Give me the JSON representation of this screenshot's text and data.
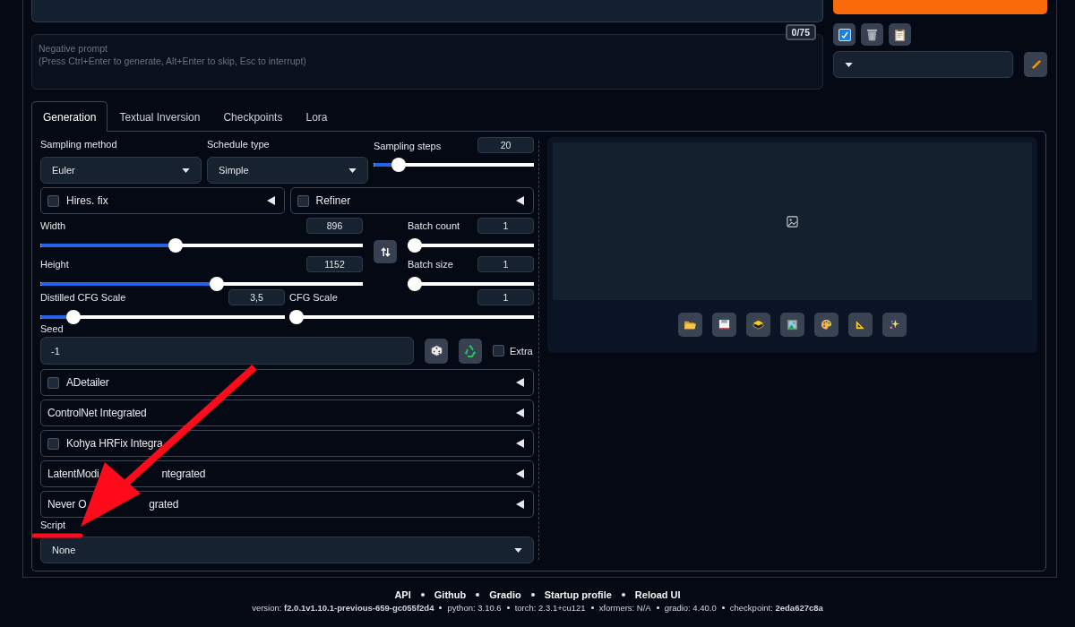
{
  "prompt": {
    "token_count": "0/75"
  },
  "negative_prompt": {
    "placeholder": "Negative prompt\n(Press Ctrl+Enter to generate, Alt+Enter to skip, Esc to interrupt)"
  },
  "tabs": [
    {
      "label": "Generation",
      "selected": true
    },
    {
      "label": "Textual Inversion",
      "selected": false
    },
    {
      "label": "Checkpoints",
      "selected": false
    },
    {
      "label": "Lora",
      "selected": false
    }
  ],
  "sampling_method": {
    "label": "Sampling method",
    "value": "Euler"
  },
  "schedule_type": {
    "label": "Schedule type",
    "value": "Simple"
  },
  "sampling_steps": {
    "label": "Sampling steps",
    "value": "20",
    "level": 0.122
  },
  "toggles": [
    {
      "label": "Hires. fix",
      "checked": false,
      "expanded": false
    },
    {
      "label": "Refiner",
      "checked": false,
      "expanded": false
    }
  ],
  "size_sliders": [
    {
      "label": "Width",
      "value": "896",
      "level": 0.417
    },
    {
      "label": "Height",
      "value": "1152",
      "level": 0.548
    }
  ],
  "batch_sliders": [
    {
      "label": "Batch count",
      "value": "1",
      "level": 0
    },
    {
      "label": "Batch size",
      "value": "1",
      "level": 0
    }
  ],
  "cfg_sliders": [
    {
      "label": "Distilled CFG Scale",
      "value": "3,5",
      "level": 0.113
    },
    {
      "label": "CFG Scale",
      "value": "1",
      "level": 0
    }
  ],
  "seed": {
    "label": "Seed",
    "value": "-1",
    "extra": {
      "label": "Extra",
      "checked": false
    }
  },
  "extensions": [
    {
      "kind": "checkbox",
      "label": "ADetailer",
      "checked": false,
      "expanded": false
    },
    {
      "kind": "plain",
      "label": "ControlNet Integrated",
      "expanded": false
    },
    {
      "kind": "checkbox",
      "label": "Kohya HRFix Integra",
      "checked": false,
      "expanded": false
    },
    {
      "kind": "plain",
      "label": "LatentModi",
      "label_after_arrow": "ntegrated",
      "expanded": false
    },
    {
      "kind": "plain",
      "label": "Never O",
      "label_after_arrow": "grated",
      "expanded": false
    }
  ],
  "script": {
    "label": "Script",
    "value": "None"
  },
  "footer": {
    "links": [
      "API",
      "Github",
      "Gradio",
      "Startup profile",
      "Reload UI"
    ],
    "versions": [
      "version: **f2.0.1v1.10.1-previous-659-gc055f2d4**",
      "python: 3.10.6",
      "torch: 2.3.1+cu121",
      "xformers: N/A",
      "gradio: 4.40.0",
      "checkpoint: **2eda627c8a**"
    ]
  }
}
